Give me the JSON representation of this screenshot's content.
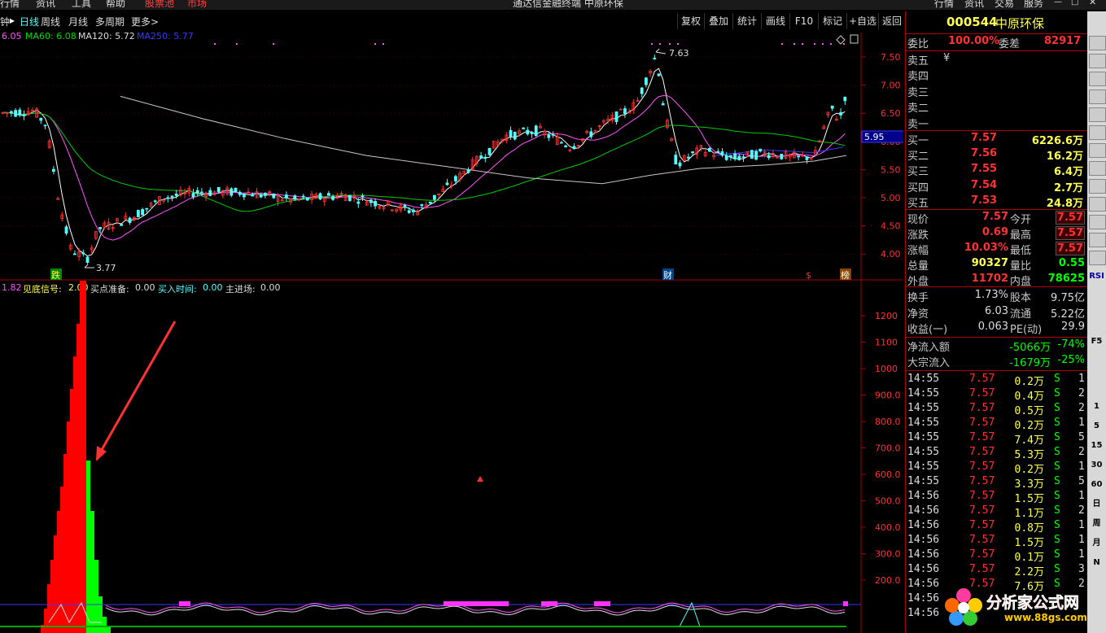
{
  "window": {
    "title": "通达信金融终端 中原环保",
    "menu": [
      "行情",
      "资讯",
      "工具",
      "帮助",
      "股票池",
      "市场"
    ],
    "right_menu": [
      "行情",
      "资讯",
      "交易",
      "服务"
    ]
  },
  "nav": {
    "tabs": [
      "日线",
      "周线",
      "月线",
      "多周期",
      "更多>"
    ],
    "prefix": "钟",
    "right_buttons": [
      "复权",
      "叠加",
      "统计",
      "画线",
      "F10",
      "标记",
      "+自选",
      "返回"
    ]
  },
  "ma_line": {
    "ma5": "6.05",
    "ma60": "MA60: 6.08",
    "ma120": "MA120: 5.72",
    "ma250": "MA250: 5.77"
  },
  "price_axis": [
    "7.50",
    "7.00",
    "6.50",
    "6.00",
    "5.50",
    "5.00",
    "4.50",
    "4.00"
  ],
  "current_price_tag": "5.95",
  "annotations": {
    "high": "7.63",
    "low": "3.77",
    "fall_marker": "跌",
    "cai_marker": "财",
    "dollar_marker": "$",
    "bang_marker": "榜"
  },
  "indicator_line": {
    "val1": "1.82",
    "label1": "见底信号:",
    "val1b": "2.00",
    "label2": "买点准备:",
    "val2": "0.00",
    "label3": "买入时间:",
    "val3": "0.00",
    "label4": "主进场:",
    "val4": "0.00"
  },
  "lower_axis": [
    "1200",
    "1100",
    "1000",
    "900.0",
    "800.0",
    "700.0",
    "600.0",
    "500.0",
    "400.0",
    "300.0",
    "200.0"
  ],
  "stock": {
    "code": "000544",
    "name": "中原环保"
  },
  "order_book": {
    "weibi_label": "委比",
    "weibi": "100.00%",
    "weicha_label": "委差",
    "weicha": "82917",
    "sell": [
      {
        "label": "卖五",
        "price": "¥",
        "vol": ""
      },
      {
        "label": "卖四",
        "price": "",
        "vol": ""
      },
      {
        "label": "卖三",
        "price": "",
        "vol": ""
      },
      {
        "label": "卖二",
        "price": "",
        "vol": ""
      },
      {
        "label": "卖一",
        "price": "",
        "vol": ""
      }
    ],
    "buy": [
      {
        "label": "买一",
        "price": "7.57",
        "vol": "6226.6万"
      },
      {
        "label": "买二",
        "price": "7.56",
        "vol": "16.2万"
      },
      {
        "label": "买三",
        "price": "7.55",
        "vol": "6.4万"
      },
      {
        "label": "买四",
        "price": "7.54",
        "vol": "2.7万"
      },
      {
        "label": "买五",
        "price": "7.53",
        "vol": "24.8万"
      }
    ]
  },
  "quote": [
    {
      "l1": "现价",
      "v1": "7.57",
      "l2": "今开",
      "v2": "7.57"
    },
    {
      "l1": "涨跌",
      "v1": "0.69",
      "l2": "最高",
      "v2": "7.57"
    },
    {
      "l1": "涨幅",
      "v1": "10.03%",
      "l2": "最低",
      "v2": "7.57"
    },
    {
      "l1": "总量",
      "v1": "90327",
      "l2": "量比",
      "v2": "0.55"
    },
    {
      "l1": "外盘",
      "v1": "11702",
      "l2": "内盘",
      "v2": "78625"
    }
  ],
  "fundamentals": [
    {
      "l1": "换手",
      "v1": "1.73%",
      "l2": "股本",
      "v2": "9.75亿"
    },
    {
      "l1": "净资",
      "v1": "6.03",
      "l2": "流通",
      "v2": "5.22亿"
    },
    {
      "l1": "收益(一)",
      "v1": "0.063",
      "l2": "PE(动)",
      "v2": "29.9"
    }
  ],
  "flow": [
    {
      "label": "净流入额",
      "value": "-5066万",
      "pct": "-74%"
    },
    {
      "label": "大宗流入",
      "value": "-1679万",
      "pct": "-25%"
    }
  ],
  "ticks": [
    {
      "t": "14:55",
      "p": "7.57",
      "v": "0.2万",
      "s": "S",
      "n": "1"
    },
    {
      "t": "14:55",
      "p": "7.57",
      "v": "0.4万",
      "s": "S",
      "n": "2"
    },
    {
      "t": "14:55",
      "p": "7.57",
      "v": "0.5万",
      "s": "S",
      "n": "2"
    },
    {
      "t": "14:55",
      "p": "7.57",
      "v": "0.2万",
      "s": "S",
      "n": "1"
    },
    {
      "t": "14:55",
      "p": "7.57",
      "v": "7.4万",
      "s": "S",
      "n": "5"
    },
    {
      "t": "14:55",
      "p": "7.57",
      "v": "5.3万",
      "s": "S",
      "n": "2"
    },
    {
      "t": "14:55",
      "p": "7.57",
      "v": "0.2万",
      "s": "S",
      "n": "1"
    },
    {
      "t": "14:55",
      "p": "7.57",
      "v": "3.3万",
      "s": "S",
      "n": "5"
    },
    {
      "t": "14:56",
      "p": "7.57",
      "v": "1.5万",
      "s": "S",
      "n": "1"
    },
    {
      "t": "14:56",
      "p": "7.57",
      "v": "1.1万",
      "s": "S",
      "n": "2"
    },
    {
      "t": "14:56",
      "p": "7.57",
      "v": "0.8万",
      "s": "S",
      "n": "1"
    },
    {
      "t": "14:56",
      "p": "7.57",
      "v": "1.5万",
      "s": "S",
      "n": "1"
    },
    {
      "t": "14:56",
      "p": "7.57",
      "v": "0.1万",
      "s": "S",
      "n": "1"
    },
    {
      "t": "14:56",
      "p": "7.57",
      "v": "2.2万",
      "s": "S",
      "n": "3"
    },
    {
      "t": "14:56",
      "p": "7.57",
      "v": "7.6万",
      "s": "S",
      "n": "2"
    },
    {
      "t": "14:56",
      "p": "",
      "v": "",
      "s": "",
      "n": ""
    },
    {
      "t": "14:56",
      "p": "",
      "v": "",
      "s": "",
      "n": ""
    }
  ],
  "watermark": {
    "site": "分析家公式网",
    "url": "www.88gs.com"
  },
  "toolbar_right": [
    "RSI",
    "F5",
    "1",
    "5",
    "15",
    "30",
    "60",
    "日",
    "周",
    "月",
    "N"
  ],
  "colors": {
    "up": "#ff3232",
    "down": "#54ffff",
    "ma5": "#ffffff",
    "ma10": "#ffff00",
    "ma20": "#ff55ff",
    "ma60": "#00cc00",
    "ma250": "#c8c8c8",
    "bar_red": "#ff0000",
    "bar_green": "#00ff00",
    "axis_red": "#a00000",
    "yellow": "#ffff54",
    "green_text": "#00ff00",
    "cyan": "#54ffff"
  }
}
